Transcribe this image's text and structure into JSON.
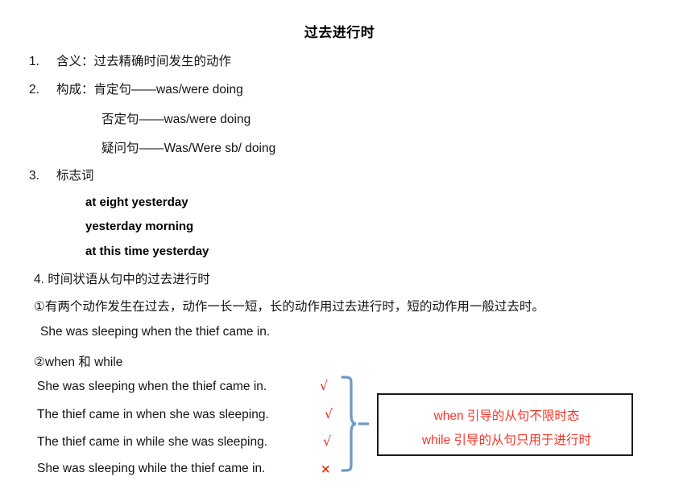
{
  "document": {
    "title": "过去进行时",
    "sections": [
      {
        "marker": "1.",
        "text": "含义：过去精确时间发生的动作"
      },
      {
        "marker": "2.",
        "text": "构成：肯定句——was/were doing"
      },
      {
        "marker": "3.",
        "text": "标志词"
      }
    ],
    "construction_sub_lines": [
      "否定句——was/were doing",
      "疑问句——Was/Were sb/ doing"
    ],
    "keywords": [
      "at eight yesterday",
      "yesterday morning",
      "at this time yesterday"
    ],
    "item4": {
      "marker": "4.",
      "text": "时间状语从句中的过去进行时"
    },
    "point1": {
      "marker": "①",
      "text": "有两个动作发生在过去，动作一长一短，长的动作用过去进行时，短的动作用一般过去时。",
      "example": "She was sleeping when the thief came in."
    },
    "point2": {
      "marker": "②",
      "text": "when 和 while"
    },
    "sentences": [
      {
        "text": "She was sleeping when the thief came in.",
        "mark": "√",
        "mark_type": "tick"
      },
      {
        "text": "The thief came in when she was sleeping.",
        "mark": "√",
        "mark_type": "tick"
      },
      {
        "text": "The thief came in while she was sleeping.",
        "mark": "√",
        "mark_type": "tick"
      },
      {
        "text": "She was sleeping while the thief came in.",
        "mark": "×",
        "mark_type": "cross"
      }
    ],
    "note_box": {
      "line1": "when 引导的从句不限时态",
      "line2": "while 引导的从句只用于进行时"
    }
  },
  "colors": {
    "text": "#141414",
    "mark_red": "#e8301b",
    "note_red": "#f2362b",
    "note_border": "#1b1b1b",
    "brace_blue": "#6f99c6"
  }
}
